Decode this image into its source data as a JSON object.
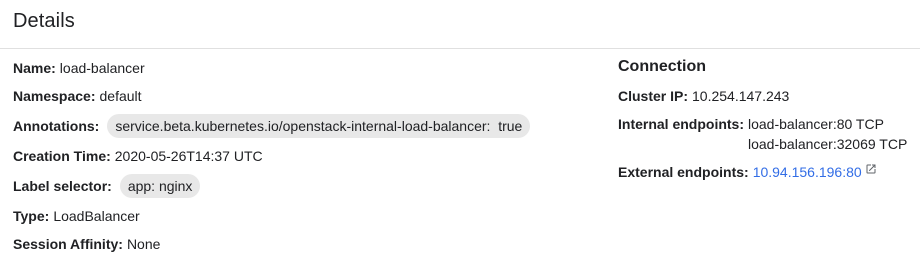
{
  "header": {
    "title": "Details"
  },
  "details": {
    "name_label": "Name:",
    "name_value": "load-balancer",
    "namespace_label": "Namespace:",
    "namespace_value": "default",
    "annotations_label": "Annotations:",
    "annotations_chip": "service.beta.kubernetes.io/openstack-internal-load-balancer:  true",
    "creation_label": "Creation Time:",
    "creation_value": "2020-05-26T14:37 UTC",
    "selector_label": "Label selector:",
    "selector_chip": "app: nginx",
    "type_label": "Type:",
    "type_value": "LoadBalancer",
    "affinity_label": "Session Affinity:",
    "affinity_value": "None"
  },
  "connection": {
    "title": "Connection",
    "cluster_ip_label": "Cluster IP:",
    "cluster_ip_value": "10.254.147.243",
    "internal_label": "Internal endpoints:",
    "internal_endpoints": [
      "load-balancer:80 TCP",
      "load-balancer:32069 TCP"
    ],
    "external_label": "External endpoints:",
    "external_endpoint": "10.94.156.196:80",
    "external_icon": "open-in-new-icon"
  },
  "colors": {
    "link": "#326de6",
    "chip_bg": "#e8e8e8",
    "divider": "#e0e0e0"
  }
}
